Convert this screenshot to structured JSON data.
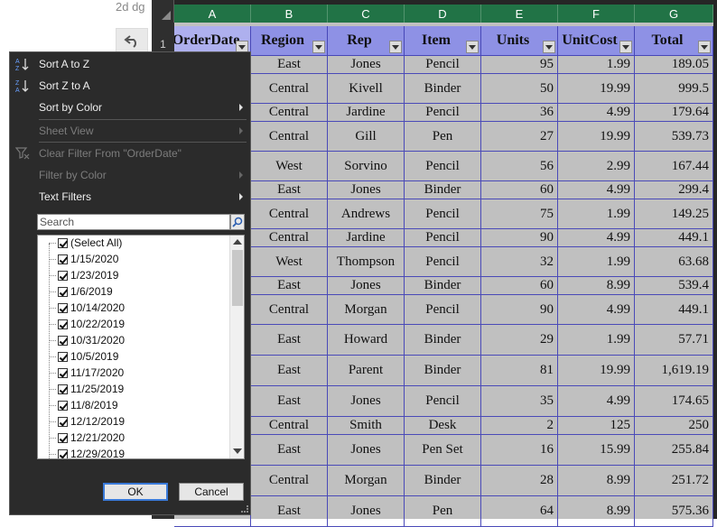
{
  "peek_text": "2d dg",
  "columns": [
    "A",
    "B",
    "C",
    "D",
    "E",
    "F",
    "G"
  ],
  "row_header": "1",
  "headers": [
    "OrderDate",
    "Region",
    "Rep",
    "Item",
    "Units",
    "UnitCost",
    "Total"
  ],
  "rows": [
    [
      "East",
      "Jones",
      "Pencil",
      "95",
      "1.99",
      "189.05"
    ],
    [
      "Central",
      "Kivell",
      "Binder",
      "50",
      "19.99",
      "999.5"
    ],
    [
      "Central",
      "Jardine",
      "Pencil",
      "36",
      "4.99",
      "179.64"
    ],
    [
      "Central",
      "Gill",
      "Pen",
      "27",
      "19.99",
      "539.73"
    ],
    [
      "West",
      "Sorvino",
      "Pencil",
      "56",
      "2.99",
      "167.44"
    ],
    [
      "East",
      "Jones",
      "Binder",
      "60",
      "4.99",
      "299.4"
    ],
    [
      "Central",
      "Andrews",
      "Pencil",
      "75",
      "1.99",
      "149.25"
    ],
    [
      "Central",
      "Jardine",
      "Pencil",
      "90",
      "4.99",
      "449.1"
    ],
    [
      "West",
      "Thompson",
      "Pencil",
      "32",
      "1.99",
      "63.68"
    ],
    [
      "East",
      "Jones",
      "Binder",
      "60",
      "8.99",
      "539.4"
    ],
    [
      "Central",
      "Morgan",
      "Pencil",
      "90",
      "4.99",
      "449.1"
    ],
    [
      "East",
      "Howard",
      "Binder",
      "29",
      "1.99",
      "57.71"
    ],
    [
      "East",
      "Parent",
      "Binder",
      "81",
      "19.99",
      "1,619.19"
    ],
    [
      "East",
      "Jones",
      "Pencil",
      "35",
      "4.99",
      "174.65"
    ],
    [
      "Central",
      "Smith",
      "Desk",
      "2",
      "125",
      "250"
    ],
    [
      "East",
      "Jones",
      "Pen Set",
      "16",
      "15.99",
      "255.84"
    ],
    [
      "Central",
      "Morgan",
      "Binder",
      "28",
      "8.99",
      "251.72"
    ],
    [
      "East",
      "Jones",
      "Pen",
      "64",
      "8.99",
      "575.36"
    ]
  ],
  "menu": {
    "sort_az": "Sort A to Z",
    "sort_za": "Sort Z to A",
    "sort_by_color": "Sort by Color",
    "sheet_view": "Sheet View",
    "clear_filter": "Clear Filter From \"OrderDate\"",
    "filter_by_color": "Filter by Color",
    "text_filters": "Text Filters",
    "search_placeholder": "Search",
    "items": [
      "(Select All)",
      "1/15/2020",
      "1/23/2019",
      "1/6/2019",
      "10/14/2020",
      "10/22/2019",
      "10/31/2020",
      "10/5/2019",
      "11/17/2020",
      "11/25/2019",
      "11/8/2019",
      "12/12/2019",
      "12/21/2020",
      "12/29/2019"
    ],
    "ok": "OK",
    "cancel": "Cancel"
  }
}
